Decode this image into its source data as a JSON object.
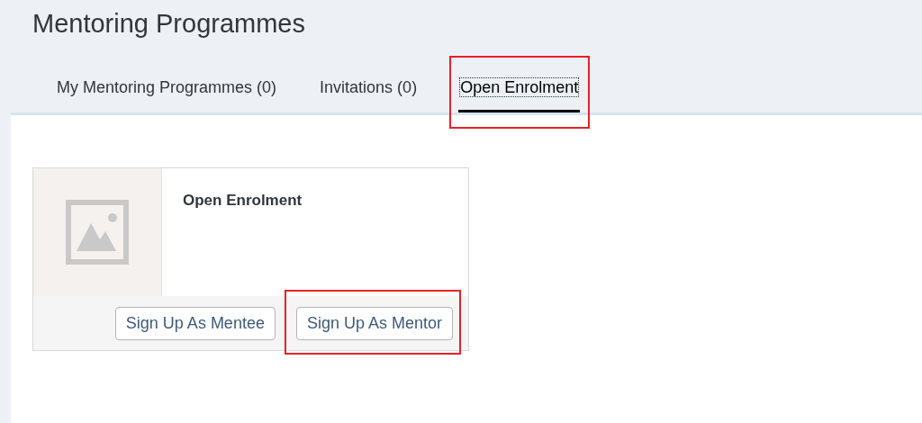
{
  "page": {
    "title": "Mentoring Programmes"
  },
  "tabs": [
    {
      "label": "My Mentoring Programmes (0)",
      "selected": false,
      "highlighted": false
    },
    {
      "label": "Invitations (0)",
      "selected": false,
      "highlighted": false
    },
    {
      "label": "Open Enrolment",
      "selected": true,
      "highlighted": true
    }
  ],
  "card": {
    "image": {
      "kind": "placeholder"
    },
    "title": "Open Enrolment",
    "buttons": [
      {
        "label": "Sign Up As Mentee",
        "highlighted": false
      },
      {
        "label": "Sign Up As Mentor",
        "highlighted": true
      }
    ]
  }
}
